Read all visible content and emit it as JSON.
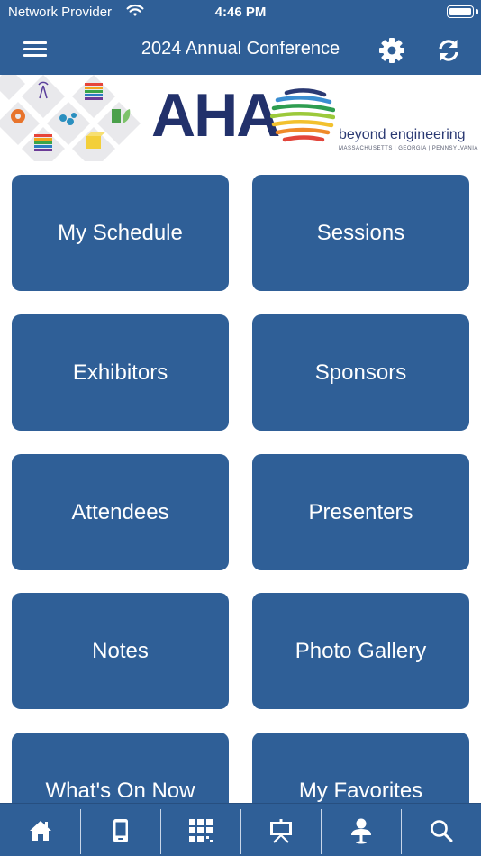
{
  "status_bar": {
    "carrier": "Network Provider",
    "time": "4:46 PM"
  },
  "nav": {
    "title": "2024 Annual Conference",
    "menu_icon": "hamburger-menu-icon",
    "settings_icon": "gear-icon",
    "refresh_icon": "refresh-icon"
  },
  "banner": {
    "logo_text": "AHA",
    "tagline": "beyond engineering",
    "states": "MASSACHUSETTS  |  GEORGIA  |  PENNSYLVANIA"
  },
  "tiles": [
    {
      "label": "My Schedule"
    },
    {
      "label": "Sessions"
    },
    {
      "label": "Exhibitors"
    },
    {
      "label": "Sponsors"
    },
    {
      "label": "Attendees"
    },
    {
      "label": "Presenters"
    },
    {
      "label": "Notes"
    },
    {
      "label": "Photo Gallery"
    },
    {
      "label": "What's On Now"
    },
    {
      "label": "My Favorites"
    }
  ],
  "tab_bar": {
    "items": [
      {
        "icon": "home-icon"
      },
      {
        "icon": "phone-icon"
      },
      {
        "icon": "qr-code-icon"
      },
      {
        "icon": "presentation-easel-icon"
      },
      {
        "icon": "speaker-person-icon"
      },
      {
        "icon": "search-icon"
      }
    ]
  },
  "colors": {
    "primary": "#2f5f97",
    "tile_text": "#ffffff",
    "logo_navy": "#22316b"
  }
}
